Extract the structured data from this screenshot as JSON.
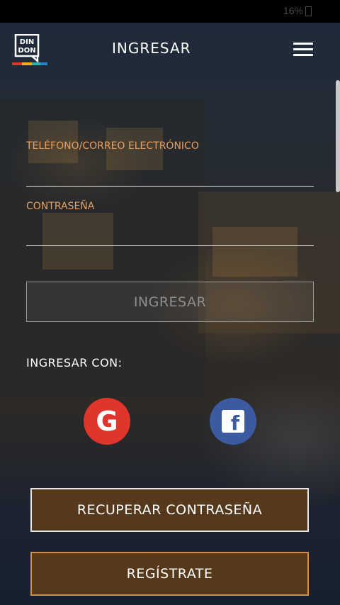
{
  "status_bar": {
    "battery_text": "16%"
  },
  "logo": {
    "line1": "DIN",
    "line2": "DON"
  },
  "header": {
    "title": "INGRESAR"
  },
  "form": {
    "phone_email_label": "TELÉFONO/CORREO ELECTRÓNICO",
    "password_label": "CONTRASEÑA",
    "login_button": "INGRESAR"
  },
  "social": {
    "label": "INGRESAR CON:",
    "google_glyph": "G",
    "facebook_glyph": "f"
  },
  "actions": {
    "recover": "RECUPERAR CONTRASEÑA",
    "register": "REGÍSTRATE"
  },
  "colors": {
    "accent_label": "#e8a060",
    "google": "#e0352b",
    "facebook": "#3b5aa0",
    "button_fill": "#5f3c19",
    "register_border": "#d98c3a"
  },
  "icons": [
    "menu-icon",
    "google-icon",
    "facebook-icon",
    "battery-icon"
  ]
}
